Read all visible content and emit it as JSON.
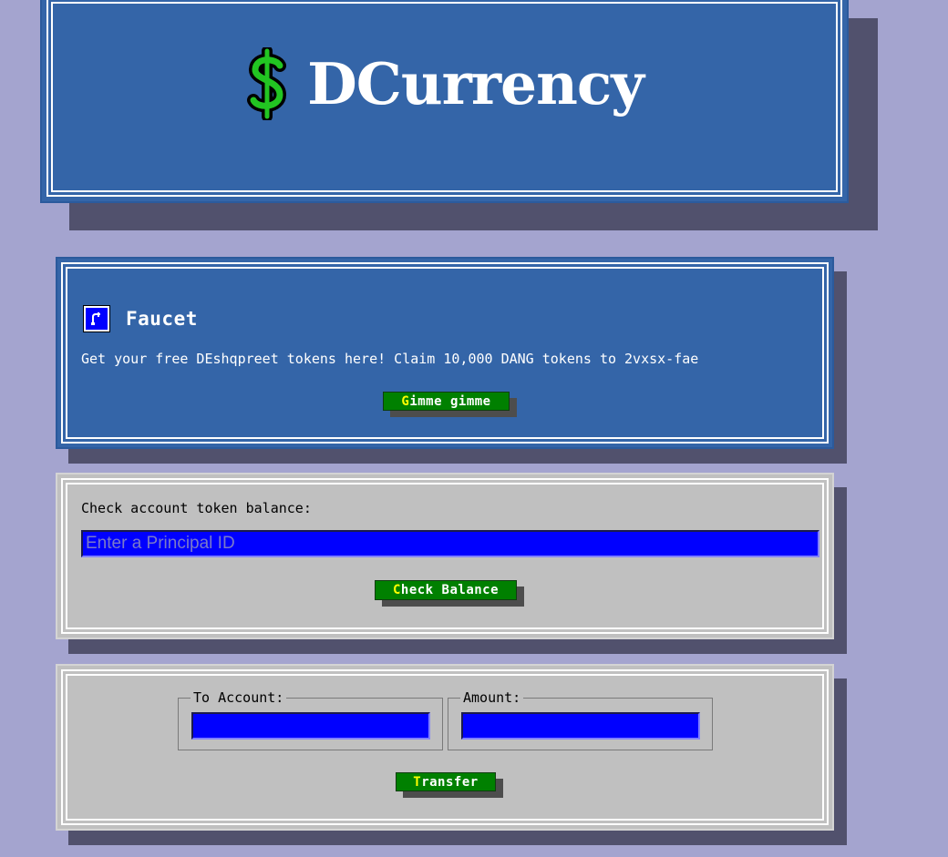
{
  "header": {
    "title": "DCurrency",
    "icon": "dollar-icon",
    "icon_color": "#22c522"
  },
  "faucet": {
    "icon": "faucet-icon",
    "title": "Faucet",
    "description": "Get your free DEshqpreet tokens here! Claim 10,000 DANG tokens to 2vxsx-fae",
    "button": {
      "accel": "G",
      "rest": "imme gimme"
    }
  },
  "balance": {
    "label": "Check account token balance:",
    "input_placeholder": "Enter a Principal ID",
    "input_value": "",
    "button": {
      "accel": "C",
      "rest": "heck Balance"
    }
  },
  "transfer": {
    "to_label": "To Account:",
    "to_value": "",
    "amount_label": "Amount:",
    "amount_value": "",
    "button": {
      "accel": "T",
      "rest": "ransfer"
    }
  },
  "colors": {
    "page_bg": "#a4a4cf",
    "panel_blue": "#3465a8",
    "panel_gray": "#c0c0c0",
    "input_bg": "#0000ff",
    "button_bg": "#008000",
    "accent_yellow": "#ffff00"
  }
}
